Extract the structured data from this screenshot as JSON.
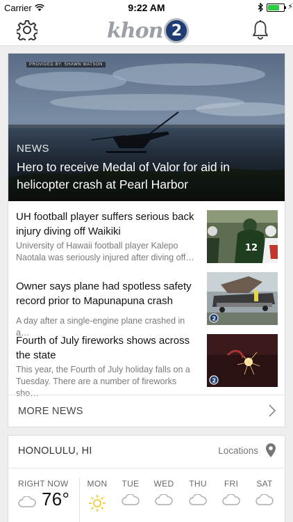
{
  "status_bar": {
    "carrier": "Carrier",
    "time": "9:22 AM"
  },
  "header": {
    "logo_text": "khon",
    "logo_number": "2",
    "settings_icon": "gear-icon",
    "notifications_icon": "bell-icon"
  },
  "top_story": {
    "credit": "PROVIDED BY: SHAWN WATSON",
    "kicker": "NEWS",
    "headline": "Hero to receive Medal of Valor for aid in helicopter crash at Pearl Harbor"
  },
  "stories": [
    {
      "title": "UH football player suffers serious back injury diving off Waikiki",
      "description": "University of Hawaii football player Kalepo Naotala was seriously injured after diving off…"
    },
    {
      "title": "Owner says plane had spotless safety record prior to Mapunapuna crash",
      "description": "A day after a single-engine plane crashed in a…"
    },
    {
      "title": "Fourth of July fireworks shows across the state",
      "description": "This year, the Fourth of July holiday falls on a Tuesday. There are a number of fireworks sho…"
    }
  ],
  "more_news": {
    "label": "MORE NEWS"
  },
  "weather": {
    "city": "HONOLULU, HI",
    "locations_label": "Locations",
    "now_label": "RIGHT NOW",
    "now_temp": "76°",
    "days": [
      "MON",
      "TUE",
      "WED",
      "THU",
      "FRI",
      "SAT"
    ]
  },
  "colors": {
    "accent_sun": "#f5c518",
    "logo_blue": "#1f3d73"
  }
}
